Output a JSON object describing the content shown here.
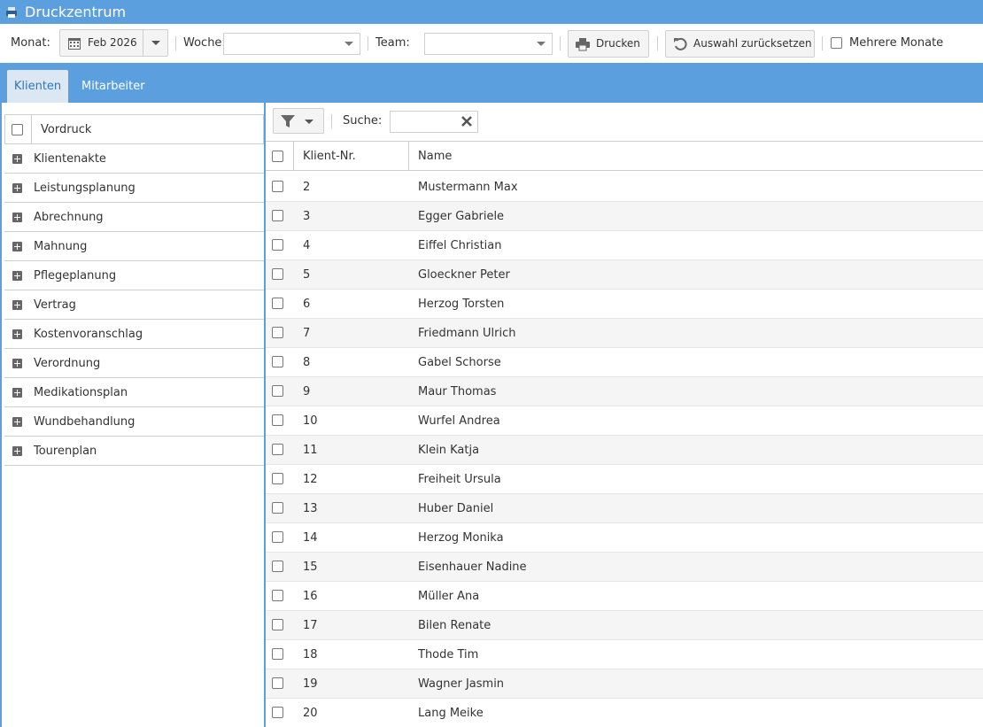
{
  "window": {
    "title": "Druckzentrum",
    "app_icon": "printer-icon"
  },
  "toolbar": {
    "month_label": "Monat:",
    "month_value": "Feb 2026",
    "week_label": "Woche:",
    "week_value": "",
    "team_label": "Team:",
    "team_value": "",
    "print_label": "Drucken",
    "reset_label": "Auswahl zurücksetzen",
    "multi_month_label": "Mehrere Monate"
  },
  "tabs": [
    {
      "label": "Klienten",
      "active": true
    },
    {
      "label": "Mitarbeiter",
      "active": false
    }
  ],
  "tree": {
    "header": "Vordruck",
    "items": [
      "Klientenakte",
      "Leistungsplanung",
      "Abrechnung",
      "Mahnung",
      "Pflegeplanung",
      "Vertrag",
      "Kostenvoranschlag",
      "Verordnung",
      "Medikationsplan",
      "Wundbehandlung",
      "Tourenplan"
    ]
  },
  "search": {
    "label": "Suche:",
    "value": ""
  },
  "grid": {
    "columns": [
      "Klient-Nr.",
      "Name"
    ],
    "rows": [
      {
        "nr": "2",
        "name": "Mustermann Max"
      },
      {
        "nr": "3",
        "name": "Egger Gabriele"
      },
      {
        "nr": "4",
        "name": "Eiffel Christian"
      },
      {
        "nr": "5",
        "name": "Gloeckner Peter"
      },
      {
        "nr": "6",
        "name": "Herzog Torsten"
      },
      {
        "nr": "7",
        "name": "Friedmann Ulrich"
      },
      {
        "nr": "8",
        "name": "Gabel Schorse"
      },
      {
        "nr": "9",
        "name": "Maur Thomas"
      },
      {
        "nr": "10",
        "name": "Wurfel Andrea"
      },
      {
        "nr": "11",
        "name": "Klein Katja"
      },
      {
        "nr": "12",
        "name": "Freiheit Ursula"
      },
      {
        "nr": "13",
        "name": "Huber Daniel"
      },
      {
        "nr": "14",
        "name": "Herzog Monika"
      },
      {
        "nr": "15",
        "name": "Eisenhauer Nadine"
      },
      {
        "nr": "16",
        "name": "Müller Ana"
      },
      {
        "nr": "17",
        "name": "Bilen Renate"
      },
      {
        "nr": "18",
        "name": "Thode Tim"
      },
      {
        "nr": "19",
        "name": "Wagner Jasmin"
      },
      {
        "nr": "20",
        "name": "Lang Meike"
      }
    ]
  },
  "colors": {
    "accent": "#5b9fde",
    "active_tab_bg": "#dbe7f3",
    "active_tab_text": "#2f76c2",
    "row_alt": "#f5f5f5"
  }
}
